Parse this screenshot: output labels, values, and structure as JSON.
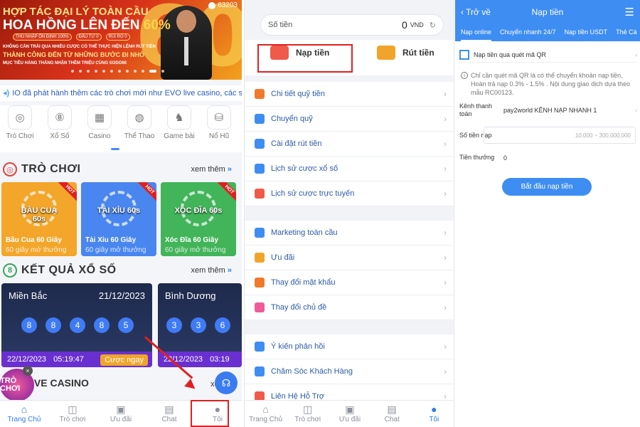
{
  "home": {
    "banner": {
      "line1": "HỢP TÁC ĐẠI LÝ TOÀN CẦU",
      "line2a": "HOA HỒNG LÊN ĐẾN ",
      "line2b": "60%",
      "chips": [
        "THU NHẬP ỔN ĐỊNH 100%",
        "ĐẦU TƯ 0",
        "RỦI RO 0"
      ],
      "line4": "KHÔNG CẦN TRẢI QUA NHIỀU CƯỢC CÓ THỂ THỰC HIỆN LỆNH RÚT TIỀN",
      "line5": "THÀNH CÔNG ĐẾN TỪ NHỮNG BƯỚC ĐI NHỎ",
      "line6": "MỤC TIÊU HÀNG THÁNG NHẬN THÊM TRIỆU CÙNG SODO66",
      "big": "60",
      "user_count": "63203"
    },
    "notice": "IO đã phát hành thêm các trò chơi mới như EVO live casino, các sảnh",
    "categories": [
      {
        "label": "Trò Chơi",
        "icon": "target-icon",
        "glyph": "◎"
      },
      {
        "label": "Xổ Số",
        "icon": "lottery-icon",
        "glyph": "⑧"
      },
      {
        "label": "Casino",
        "icon": "cards-icon",
        "glyph": "▦"
      },
      {
        "label": "Thể Thao",
        "icon": "ball-icon",
        "glyph": "◍"
      },
      {
        "label": "Game bài",
        "icon": "chess-icon",
        "glyph": "♞"
      },
      {
        "label": "Nổ Hũ",
        "icon": "jackpot-icon",
        "glyph": "⛁"
      }
    ],
    "games_section": {
      "title": "TRÒ CHƠI",
      "more": "xem thêm",
      "more_arrow": "»"
    },
    "games": [
      {
        "logo": "BẦU CUA 60s",
        "title": "Bầu Cua 60 Giây",
        "sub": "60 giây mở thưởng",
        "hot": "HOT",
        "color": "#f3a62a"
      },
      {
        "logo": "TÀI XỈU 60s",
        "title": "Tài Xỉu 60 Giây",
        "sub": "60 giây mở thưởng",
        "hot": "HOT",
        "color": "#4a86ef"
      },
      {
        "logo": "XÓC ĐĨA 60s",
        "title": "Xóc Đĩa 60 Giây",
        "sub": "60 giây mở thưởng",
        "hot": "HOT",
        "color": "#42b45a"
      }
    ],
    "lottery_section": {
      "title": "KẾT QUẢ XỔ SỐ",
      "more": "xem thêm",
      "more_arrow": "»"
    },
    "lottery": [
      {
        "name": "Miền Bắc",
        "date": "21/12/2023",
        "balls": [
          "8",
          "8",
          "4",
          "8",
          "5"
        ],
        "next_date": "22/12/2023",
        "next_time": "05:19:47",
        "bet": "Cược ngay"
      },
      {
        "name": "Bình Dương",
        "date": "",
        "balls": [
          "3",
          "3",
          "6"
        ],
        "next_date": "22/12/2023",
        "next_time": "03:19",
        "bet": ""
      }
    ],
    "live_title": "IVE CASINO",
    "live_more": "xem th",
    "floater": "TRÒ CHƠI",
    "floater_close": "×",
    "tabs": [
      {
        "label": "Trang Chủ",
        "icon": "home-icon",
        "glyph": "⌂",
        "active": true
      },
      {
        "label": "Trò chơi",
        "icon": "gamepad-icon",
        "glyph": "◫",
        "active": false
      },
      {
        "label": "Ưu đãi",
        "icon": "gift-icon",
        "glyph": "▣",
        "active": false
      },
      {
        "label": "Chat",
        "icon": "chat-icon",
        "glyph": "▤",
        "active": false
      },
      {
        "label": "Tôi",
        "icon": "user-icon",
        "glyph": "●",
        "active": false
      }
    ]
  },
  "account": {
    "balance_label": "Số tiền",
    "balance_value": "0",
    "currency": "VND",
    "refresh_glyph": "↻",
    "deposit": "Nạp tiền",
    "withdraw": "Rút tiền",
    "group1": [
      {
        "label": "Chi tiết quỹ tiền",
        "icon": "fund-details-icon",
        "color": "#f07a2a"
      },
      {
        "label": "Chuyển quỹ",
        "icon": "transfer-icon",
        "color": "#3e8df2"
      },
      {
        "label": "Cài đặt rút tiền",
        "icon": "withdraw-settings-icon",
        "color": "#3e8df2"
      },
      {
        "label": "Lịch sử cược xổ số",
        "icon": "lottery-history-icon",
        "color": "#3e8df2"
      },
      {
        "label": "Lịch sử cược trực tuyến",
        "icon": "online-history-icon",
        "color": "#f05a4a"
      }
    ],
    "group2": [
      {
        "label": "Marketing toàn cầu",
        "icon": "marketing-icon",
        "color": "#3e8df2"
      },
      {
        "label": "Ưu đãi",
        "icon": "promo-icon",
        "color": "#f0a52a"
      },
      {
        "label": "Thay đổi mật khẩu",
        "icon": "lock-icon",
        "color": "#f07a2a"
      },
      {
        "label": "Thay đổi chủ đề",
        "icon": "theme-icon",
        "color": "#f05a9a"
      }
    ],
    "group3": [
      {
        "label": "Ý kiến phản hồi",
        "icon": "feedback-icon",
        "color": "#3e8df2"
      },
      {
        "label": "Chăm Sóc Khách Hàng",
        "icon": "support-icon",
        "color": "#3e8df2"
      },
      {
        "label": "Liên Hệ Hỗ Trợ",
        "icon": "contact-icon",
        "color": "#f05a4a"
      }
    ],
    "chevron": "›",
    "tabs": [
      {
        "label": "Trang Chủ",
        "icon": "home-icon",
        "glyph": "⌂",
        "active": false
      },
      {
        "label": "Trò chơi",
        "icon": "gamepad-icon",
        "glyph": "◫",
        "active": false
      },
      {
        "label": "Ưu đãi",
        "icon": "gift-icon",
        "glyph": "▣",
        "active": false
      },
      {
        "label": "Chat",
        "icon": "chat-icon",
        "glyph": "▤",
        "active": false
      },
      {
        "label": "Tôi",
        "icon": "user-icon",
        "glyph": "●",
        "active": true
      }
    ]
  },
  "deposit": {
    "back": "‹ Trở về",
    "title": "Nạp tiền",
    "menu_glyph": "☰",
    "tabs": [
      "Nạp online",
      "Chuyển nhanh 24/7",
      "Nạp tiền USDT",
      "Thẻ Cà"
    ],
    "qr_label": "Nạp tiền qua quét mã QR",
    "note": "Chỉ cần quét mã QR là có thể chuyển khoản nạp tiền, Hoàn trả nạp 0.3% - 1.5% . Nội dung giao dịch dựa theo mẫu RC00123.",
    "channel_label": "Kênh thanh toán",
    "channel_value": "pay2world KÊNH NẠP NHANH 1",
    "amount_label": "Số tiền nạp",
    "amount_placeholder": "10,000 ~ 300,000,000",
    "bonus_label": "Tiền thưởng",
    "bonus_value": "0",
    "start_button": "Bắt đầu nạp tiền"
  },
  "colors": {
    "accent": "#3e8df2",
    "highlight": "#e02020",
    "lottery_footer": "#6a2fd0",
    "bet": "#f0a52a"
  }
}
